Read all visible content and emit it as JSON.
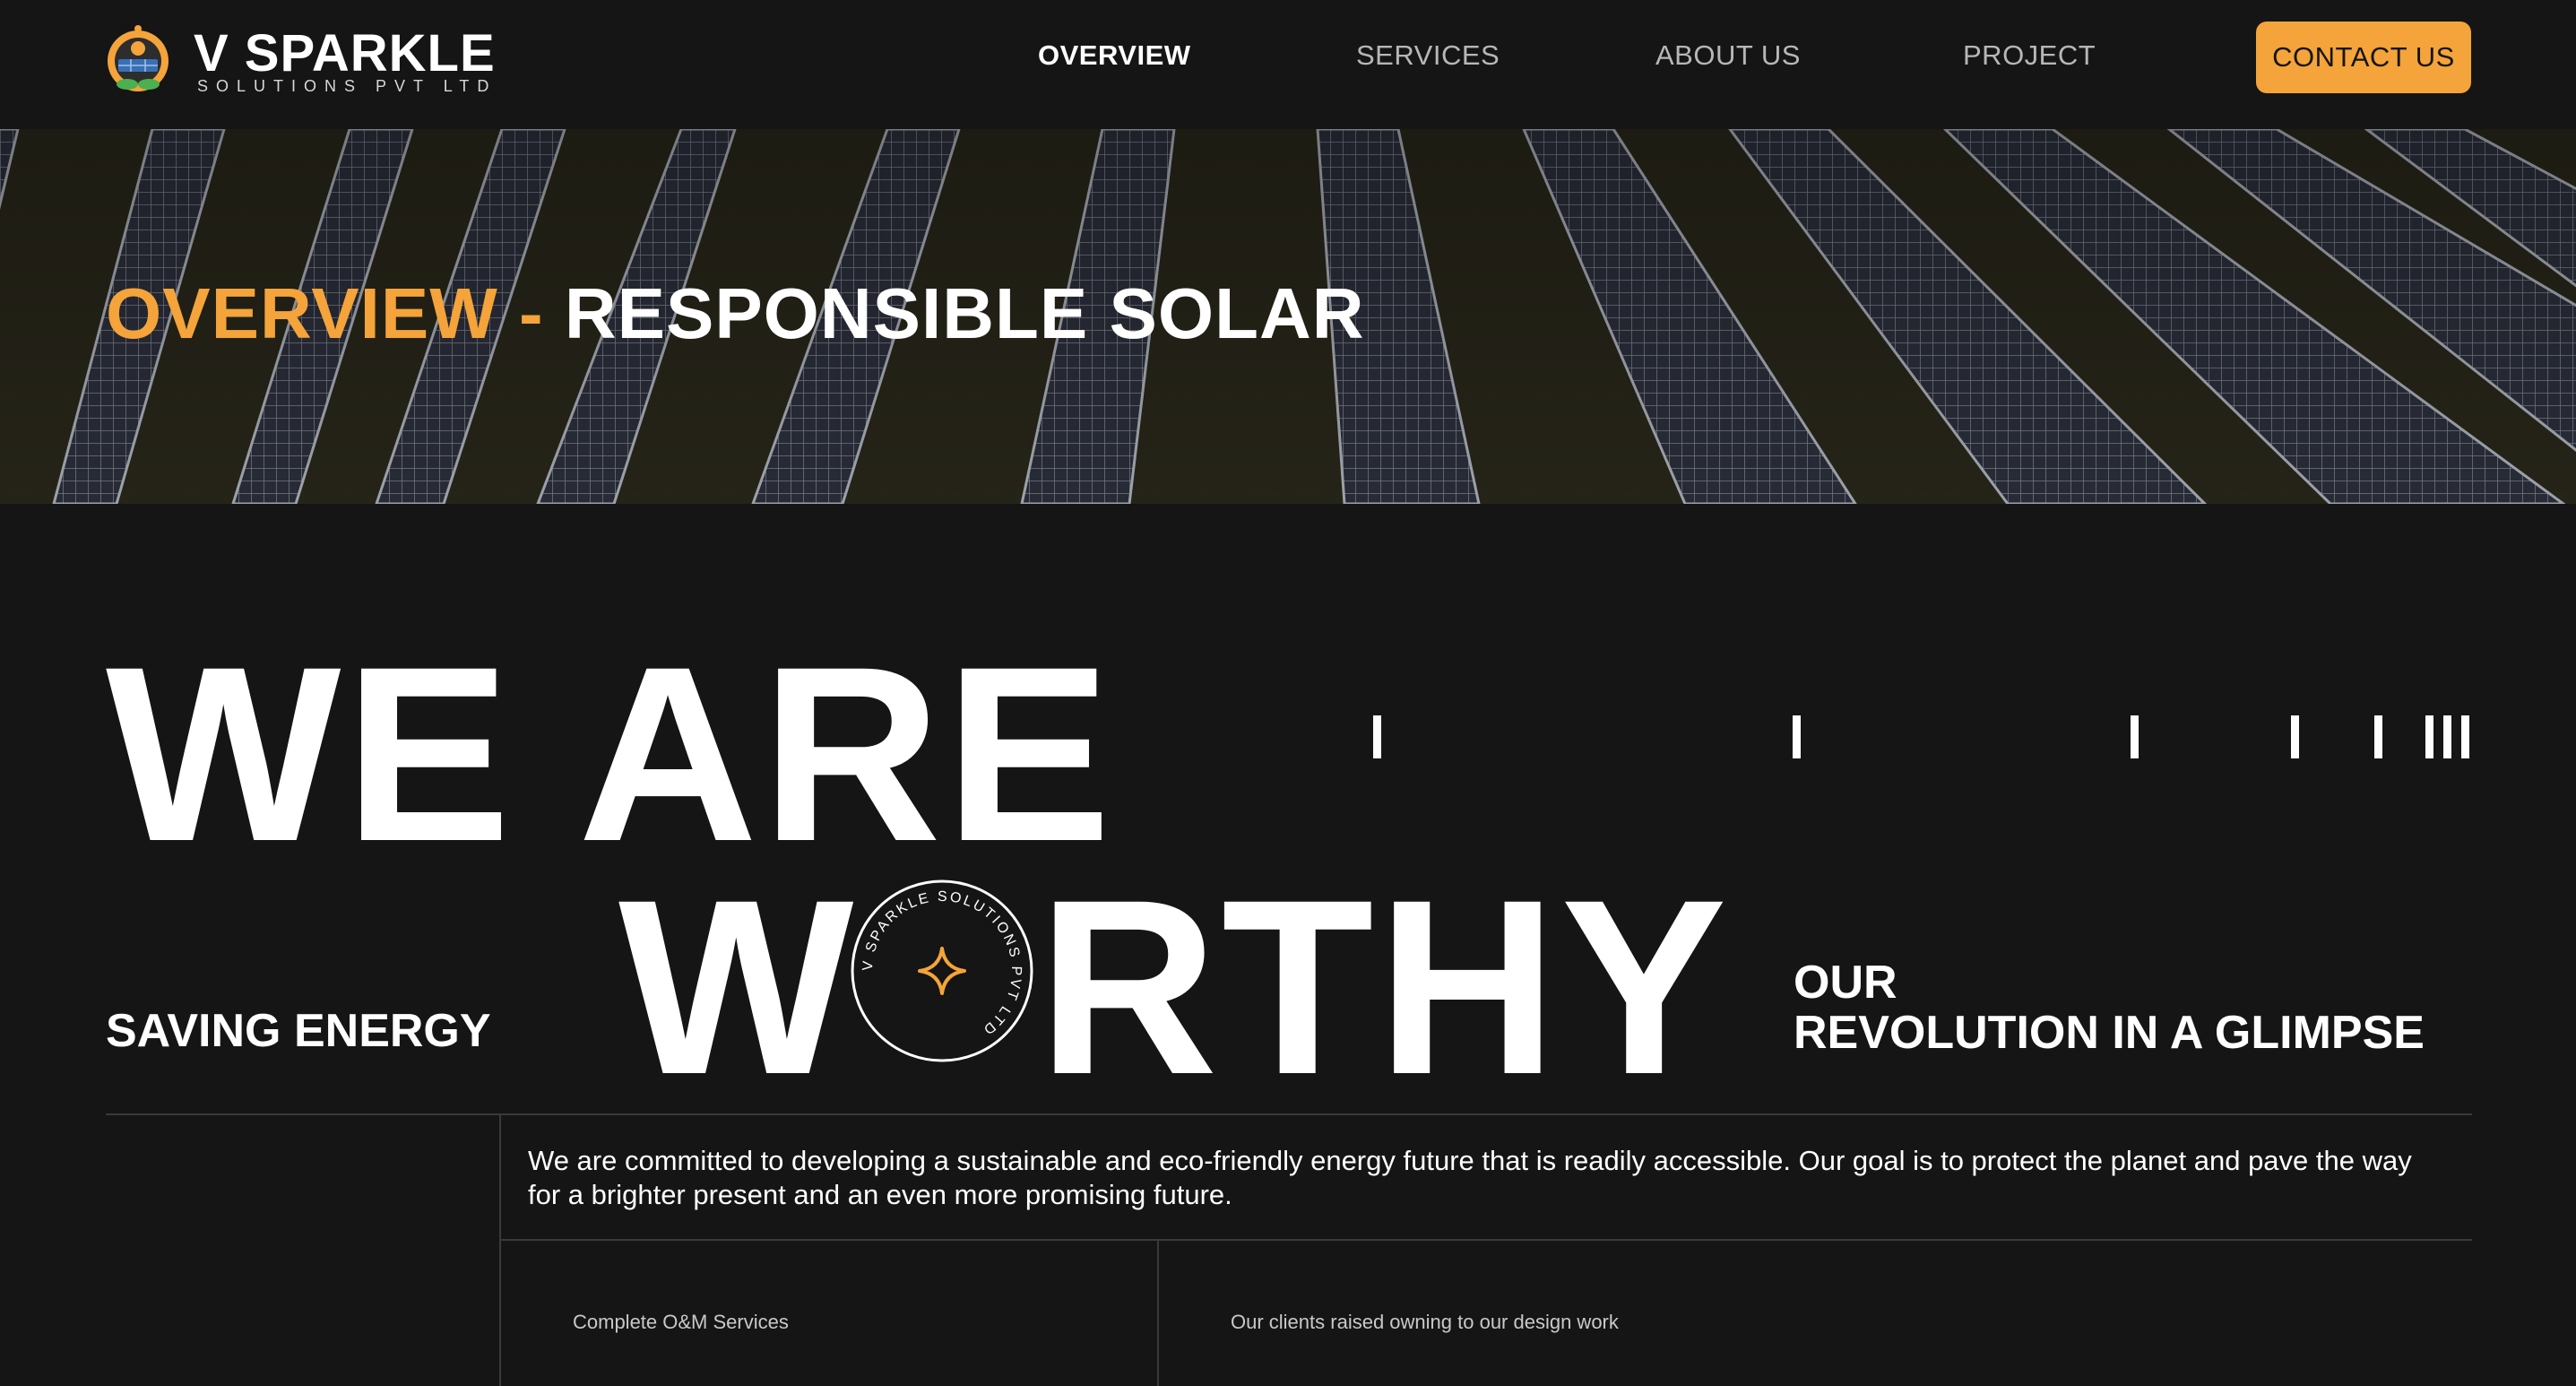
{
  "brand": {
    "name": "V SPARKLE",
    "subtitle": "SOLUTIONS PVT LTD"
  },
  "nav": {
    "items": [
      {
        "label": "OVERVIEW",
        "active": true
      },
      {
        "label": "SERVICES",
        "active": false
      },
      {
        "label": "ABOUT US",
        "active": false
      },
      {
        "label": "PROJECT",
        "active": false
      }
    ],
    "cta_label": "CONTACT US"
  },
  "banner": {
    "accent": "OVERVIEW -",
    "title": "RESPONSIBLE SOLAR"
  },
  "headline": {
    "line1": "WE ARE",
    "line2_w": "W",
    "line2_rest": "RTHY",
    "badge_text": "V SPARKLE SOLUTIONS PVT LTD"
  },
  "labels": {
    "saving": "SAVING ENERGY",
    "glimpse_line1": "OUR",
    "glimpse_line2": "REVOLUTION IN A GLIMPSE"
  },
  "mission": "We are committed to developing a sustainable and eco-friendly energy future that is readily accessible. Our goal is to protect the planet and pave the way for a brighter present and an even more promising future.",
  "features": [
    "Complete O&M Services",
    "Our clients raised owning to our design work"
  ],
  "colors": {
    "background": "#151515",
    "accent": "#f4a43a",
    "text": "#ffffff",
    "muted": "#b7b7b7"
  }
}
